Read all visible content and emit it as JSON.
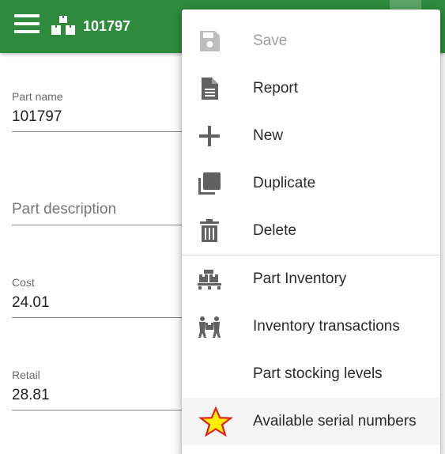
{
  "header": {
    "title": "101797",
    "menu_icon": "hamburger-menu-icon",
    "app_icon": "boxes-icon",
    "color": "#2e8b3d"
  },
  "form": {
    "part_name": {
      "label": "Part name",
      "value": "101797"
    },
    "part_description": {
      "placeholder": "Part description"
    },
    "cost": {
      "label": "Cost",
      "value": "24.01"
    },
    "retail": {
      "label": "Retail",
      "value": "28.81"
    }
  },
  "menu": {
    "items": [
      {
        "label": "Save",
        "icon": "save-icon",
        "disabled": true
      },
      {
        "label": "Report",
        "icon": "document-icon"
      },
      {
        "label": "New",
        "icon": "plus-icon"
      },
      {
        "label": "Duplicate",
        "icon": "copy-icon"
      },
      {
        "label": "Delete",
        "icon": "trash-icon"
      },
      {
        "label": "Part Inventory",
        "icon": "pallet-icon"
      },
      {
        "label": "Inventory transactions",
        "icon": "people-carry-icon"
      },
      {
        "label": "Part stocking levels",
        "icon": ""
      },
      {
        "label": "Available serial numbers",
        "icon": "star-icon",
        "highlighted": true
      }
    ]
  },
  "colors": {
    "icon_gray": "#616161",
    "star_fill": "#ffee00",
    "star_stroke": "#e02020"
  }
}
